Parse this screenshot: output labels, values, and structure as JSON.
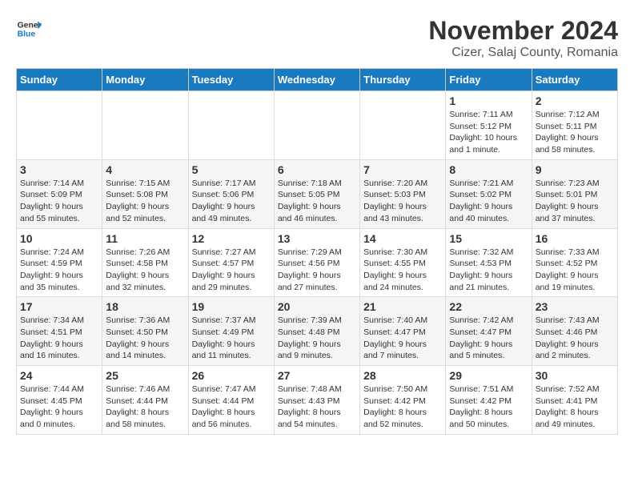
{
  "logo": {
    "line1": "General",
    "line2": "Blue"
  },
  "title": "November 2024",
  "subtitle": "Cizer, Salaj County, Romania",
  "days_of_week": [
    "Sunday",
    "Monday",
    "Tuesday",
    "Wednesday",
    "Thursday",
    "Friday",
    "Saturday"
  ],
  "weeks": [
    [
      {
        "day": "",
        "info": ""
      },
      {
        "day": "",
        "info": ""
      },
      {
        "day": "",
        "info": ""
      },
      {
        "day": "",
        "info": ""
      },
      {
        "day": "",
        "info": ""
      },
      {
        "day": "1",
        "info": "Sunrise: 7:11 AM\nSunset: 5:12 PM\nDaylight: 10 hours and 1 minute."
      },
      {
        "day": "2",
        "info": "Sunrise: 7:12 AM\nSunset: 5:11 PM\nDaylight: 9 hours and 58 minutes."
      }
    ],
    [
      {
        "day": "3",
        "info": "Sunrise: 7:14 AM\nSunset: 5:09 PM\nDaylight: 9 hours and 55 minutes."
      },
      {
        "day": "4",
        "info": "Sunrise: 7:15 AM\nSunset: 5:08 PM\nDaylight: 9 hours and 52 minutes."
      },
      {
        "day": "5",
        "info": "Sunrise: 7:17 AM\nSunset: 5:06 PM\nDaylight: 9 hours and 49 minutes."
      },
      {
        "day": "6",
        "info": "Sunrise: 7:18 AM\nSunset: 5:05 PM\nDaylight: 9 hours and 46 minutes."
      },
      {
        "day": "7",
        "info": "Sunrise: 7:20 AM\nSunset: 5:03 PM\nDaylight: 9 hours and 43 minutes."
      },
      {
        "day": "8",
        "info": "Sunrise: 7:21 AM\nSunset: 5:02 PM\nDaylight: 9 hours and 40 minutes."
      },
      {
        "day": "9",
        "info": "Sunrise: 7:23 AM\nSunset: 5:01 PM\nDaylight: 9 hours and 37 minutes."
      }
    ],
    [
      {
        "day": "10",
        "info": "Sunrise: 7:24 AM\nSunset: 4:59 PM\nDaylight: 9 hours and 35 minutes."
      },
      {
        "day": "11",
        "info": "Sunrise: 7:26 AM\nSunset: 4:58 PM\nDaylight: 9 hours and 32 minutes."
      },
      {
        "day": "12",
        "info": "Sunrise: 7:27 AM\nSunset: 4:57 PM\nDaylight: 9 hours and 29 minutes."
      },
      {
        "day": "13",
        "info": "Sunrise: 7:29 AM\nSunset: 4:56 PM\nDaylight: 9 hours and 27 minutes."
      },
      {
        "day": "14",
        "info": "Sunrise: 7:30 AM\nSunset: 4:55 PM\nDaylight: 9 hours and 24 minutes."
      },
      {
        "day": "15",
        "info": "Sunrise: 7:32 AM\nSunset: 4:53 PM\nDaylight: 9 hours and 21 minutes."
      },
      {
        "day": "16",
        "info": "Sunrise: 7:33 AM\nSunset: 4:52 PM\nDaylight: 9 hours and 19 minutes."
      }
    ],
    [
      {
        "day": "17",
        "info": "Sunrise: 7:34 AM\nSunset: 4:51 PM\nDaylight: 9 hours and 16 minutes."
      },
      {
        "day": "18",
        "info": "Sunrise: 7:36 AM\nSunset: 4:50 PM\nDaylight: 9 hours and 14 minutes."
      },
      {
        "day": "19",
        "info": "Sunrise: 7:37 AM\nSunset: 4:49 PM\nDaylight: 9 hours and 11 minutes."
      },
      {
        "day": "20",
        "info": "Sunrise: 7:39 AM\nSunset: 4:48 PM\nDaylight: 9 hours and 9 minutes."
      },
      {
        "day": "21",
        "info": "Sunrise: 7:40 AM\nSunset: 4:47 PM\nDaylight: 9 hours and 7 minutes."
      },
      {
        "day": "22",
        "info": "Sunrise: 7:42 AM\nSunset: 4:47 PM\nDaylight: 9 hours and 5 minutes."
      },
      {
        "day": "23",
        "info": "Sunrise: 7:43 AM\nSunset: 4:46 PM\nDaylight: 9 hours and 2 minutes."
      }
    ],
    [
      {
        "day": "24",
        "info": "Sunrise: 7:44 AM\nSunset: 4:45 PM\nDaylight: 9 hours and 0 minutes."
      },
      {
        "day": "25",
        "info": "Sunrise: 7:46 AM\nSunset: 4:44 PM\nDaylight: 8 hours and 58 minutes."
      },
      {
        "day": "26",
        "info": "Sunrise: 7:47 AM\nSunset: 4:44 PM\nDaylight: 8 hours and 56 minutes."
      },
      {
        "day": "27",
        "info": "Sunrise: 7:48 AM\nSunset: 4:43 PM\nDaylight: 8 hours and 54 minutes."
      },
      {
        "day": "28",
        "info": "Sunrise: 7:50 AM\nSunset: 4:42 PM\nDaylight: 8 hours and 52 minutes."
      },
      {
        "day": "29",
        "info": "Sunrise: 7:51 AM\nSunset: 4:42 PM\nDaylight: 8 hours and 50 minutes."
      },
      {
        "day": "30",
        "info": "Sunrise: 7:52 AM\nSunset: 4:41 PM\nDaylight: 8 hours and 49 minutes."
      }
    ]
  ]
}
